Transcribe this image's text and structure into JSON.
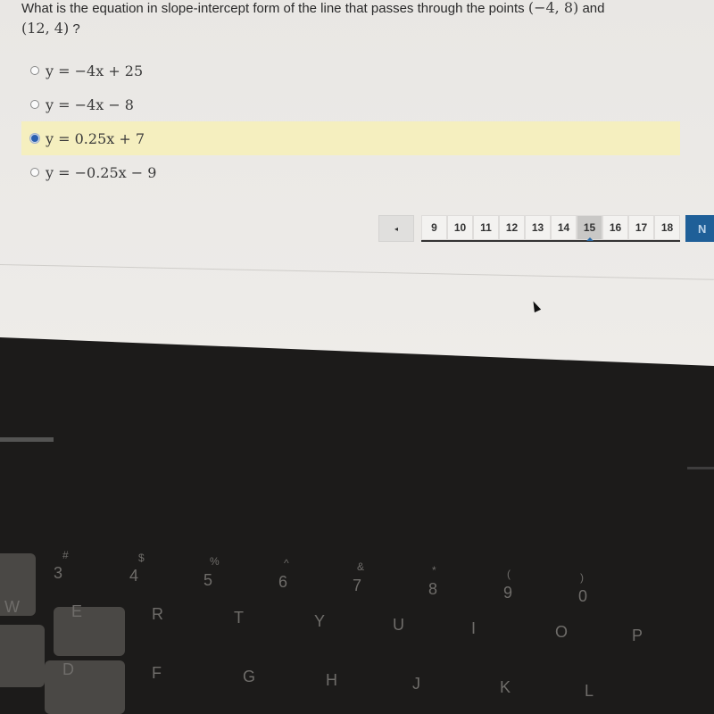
{
  "question": {
    "text_before": "What is the equation in slope-intercept form of the line that passes through the points",
    "point1": "(−4, 8)",
    "text_mid": "and",
    "point2": "(12, 4)",
    "text_after": "?"
  },
  "options": [
    {
      "label": "y = −4x + 25",
      "selected": false
    },
    {
      "label": "y = −4x − 8",
      "selected": false
    },
    {
      "label": "y = 0.25x + 7",
      "selected": true
    },
    {
      "label": "y = −0.25x − 9",
      "selected": false
    }
  ],
  "pagination": {
    "prev_icon": "◂",
    "pages": [
      "9",
      "10",
      "11",
      "12",
      "13",
      "14",
      "15",
      "16",
      "17",
      "18"
    ],
    "current": "15",
    "next_label": "N"
  },
  "keyboard": {
    "number_row": [
      "#",
      "3",
      "$",
      "4",
      "%",
      "5",
      "^",
      "6",
      "&",
      "7",
      "*",
      "8",
      "(",
      "9",
      ")",
      "0"
    ],
    "row1": [
      "W",
      "E",
      "R",
      "T",
      "Y",
      "U",
      "I",
      "O",
      "P"
    ],
    "row2": [
      "D",
      "F",
      "G",
      "H",
      "J",
      "K",
      "L"
    ]
  }
}
